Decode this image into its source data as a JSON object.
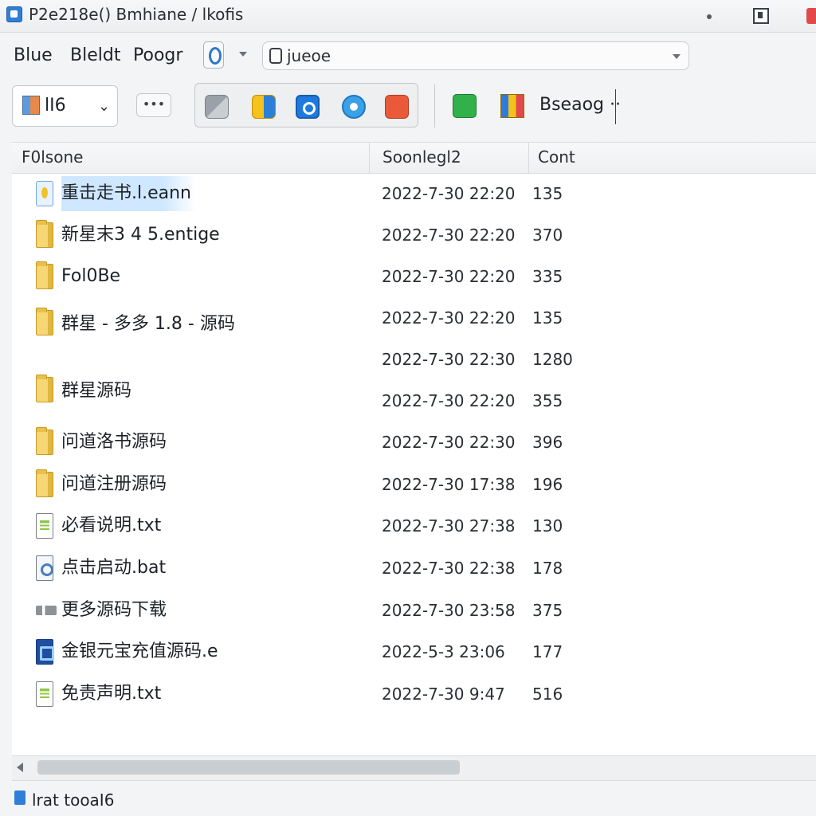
{
  "window": {
    "title": "P2e218e() Bmhiane / lkofis"
  },
  "menu": {
    "items": [
      "Blue",
      "Bleldt",
      "Poogr"
    ],
    "address": "jueoe"
  },
  "toolbar": {
    "view_label": "lI6",
    "more_label": "•••",
    "right_label": "Bseaog ··"
  },
  "columns": {
    "name": "F0lsone",
    "date": "Soonlegl2",
    "count": "Cont"
  },
  "files": [
    {
      "name": "重击走书.l.eann",
      "date": "2022-7-30 22:20",
      "count": "135",
      "icon": "selected-file-icon"
    },
    {
      "name": "新星末3 4 5.entige",
      "date": "2022-7-30 22:20",
      "count": "370",
      "icon": "folder-icon"
    },
    {
      "name": "Fol0Be",
      "date": "2022-7-30 22:20",
      "count": "335",
      "icon": "folder-icon"
    },
    {
      "name": "群星 - 多多 1.8 - 源码",
      "date": "2022-7-30 22:20",
      "count": "135",
      "icon": "folder-icon"
    },
    {
      "name": "",
      "date": "2022-7-30 22:30",
      "count": "1280",
      "icon": ""
    },
    {
      "name": "群星源码",
      "date": "2022-7-30 22:20",
      "count": "355",
      "icon": "folder-icon"
    },
    {
      "name": "问道洛书源码",
      "date": "2022-7-30 22:30",
      "count": "396",
      "icon": "folder-icon"
    },
    {
      "name": "问道注册源码",
      "date": "2022-7-30 17:38",
      "count": "196",
      "icon": "folder-icon"
    },
    {
      "name": "必看说明.txt",
      "date": "2022-7-30 27:38",
      "count": "130",
      "icon": "text-file-icon"
    },
    {
      "name": "点击启动.bat",
      "date": "2022-7-30 22:38",
      "count": "178",
      "icon": "batch-file-icon"
    },
    {
      "name": "更多源码下载",
      "date": "2022-7-30 23:58",
      "count": "375",
      "icon": "shortcut-icon"
    },
    {
      "name": "金银元宝充值源码.e",
      "date": "2022-5-3 23:06",
      "count": "177",
      "icon": "exe-icon"
    },
    {
      "name": "免责声明.txt",
      "date": "2022-7-30 9:47",
      "count": "516",
      "icon": "text-file-icon"
    }
  ],
  "status": {
    "text": "lrat  tooaI6"
  },
  "colors": {
    "selected_row": "#cfe7ff",
    "folder": "#f6d675",
    "accent": "#2f7fd8"
  }
}
